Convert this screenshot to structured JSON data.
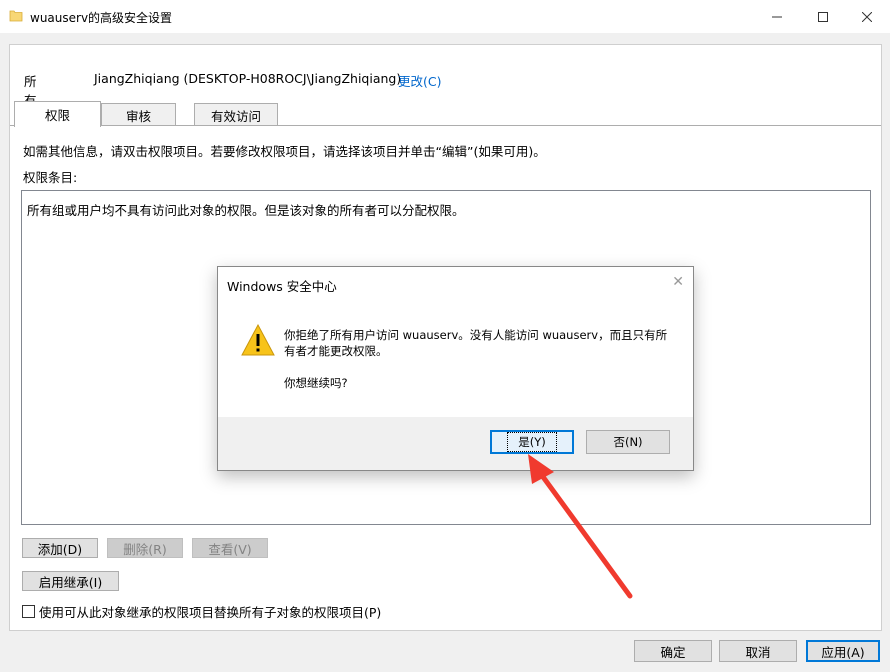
{
  "window": {
    "title": "wuauserv的高级安全设置",
    "minimize_icon": "minimize-icon",
    "maximize_icon": "maximize-icon",
    "close_icon": "close-icon"
  },
  "owner": {
    "label": "所有者:",
    "value": "JiangZhiqiang (DESKTOP-H08ROCJ\\JiangZhiqiang)",
    "change_link": "更改(C)"
  },
  "tabs": [
    {
      "label": "权限",
      "active": true
    },
    {
      "label": "审核",
      "active": false
    },
    {
      "label": "有效访问",
      "active": false
    }
  ],
  "permissions": {
    "info": "如需其他信息，请双击权限项目。若要修改权限项目，请选择该项目并单击“编辑”(如果可用)。",
    "entries_label": "权限条目:",
    "empty_message": "所有组或用户均不具有访问此对象的权限。但是该对象的所有者可以分配权限。",
    "add_button": "添加(D)",
    "remove_button": "删除(R)",
    "view_button": "查看(V)",
    "enable_inheritance_button": "启用继承(I)",
    "replace_checkbox": "使用可从此对象继承的权限项目替换所有子对象的权限项目(P)"
  },
  "footer": {
    "ok": "确定",
    "cancel": "取消",
    "apply": "应用(A)"
  },
  "dialog": {
    "title": "Windows 安全中心",
    "message": "你拒绝了所有用户访问 wuauserv。没有人能访问 wuauserv，而且只有所有者才能更改权限。",
    "question": "你想继续吗?",
    "yes": "是(Y)",
    "no": "否(N)",
    "icon": "warning-icon"
  },
  "colors": {
    "link": "#0066cc",
    "accent": "#0078d7",
    "annotation_arrow": "#f03a2e",
    "warning_yellow": "#f7c31a"
  }
}
